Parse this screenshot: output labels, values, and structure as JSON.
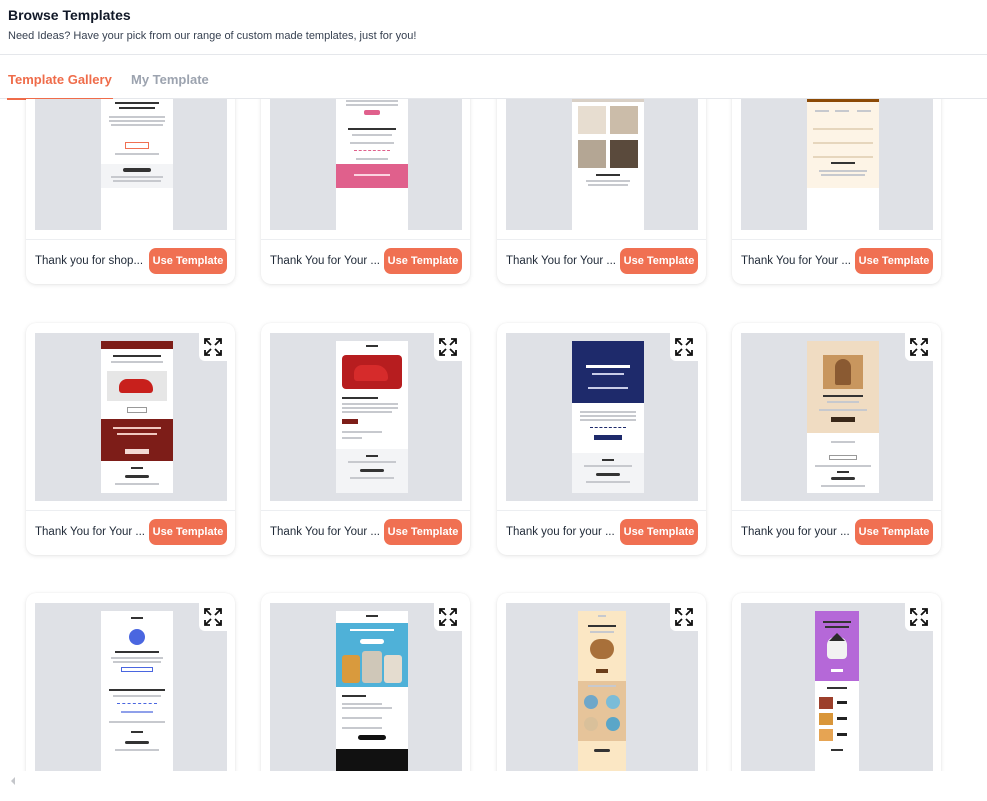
{
  "header": {
    "title": "Browse Templates",
    "subtitle": "Need Ideas? Have your pick from our range of custom made templates, just for you!"
  },
  "tabs": [
    {
      "label": "Template Gallery",
      "active": true
    },
    {
      "label": "My Template",
      "active": false
    }
  ],
  "accent_color": "#ef6c4a",
  "button_color": "#f07052",
  "preview_bg": "#dfe1e6",
  "templates": [
    {
      "name": "Thank you for shop...",
      "button": "Use Template"
    },
    {
      "name": "Thank You for Your ...",
      "button": "Use Template"
    },
    {
      "name": "Thank You for Your ...",
      "button": "Use Template"
    },
    {
      "name": "Thank You for Your ...",
      "button": "Use Template"
    },
    {
      "name": "Thank You for Your ...",
      "button": "Use Template"
    },
    {
      "name": "Thank You for Your ...",
      "button": "Use Template"
    },
    {
      "name": "Thank you for your ...",
      "button": "Use Template"
    },
    {
      "name": "Thank you for your ...",
      "button": "Use Template"
    },
    {
      "name": "",
      "button": ""
    },
    {
      "name": "",
      "button": ""
    },
    {
      "name": "",
      "button": ""
    },
    {
      "name": "",
      "button": ""
    }
  ],
  "icons": {
    "expand": "expand-icon",
    "scroll_left": "chevron-left-icon"
  }
}
